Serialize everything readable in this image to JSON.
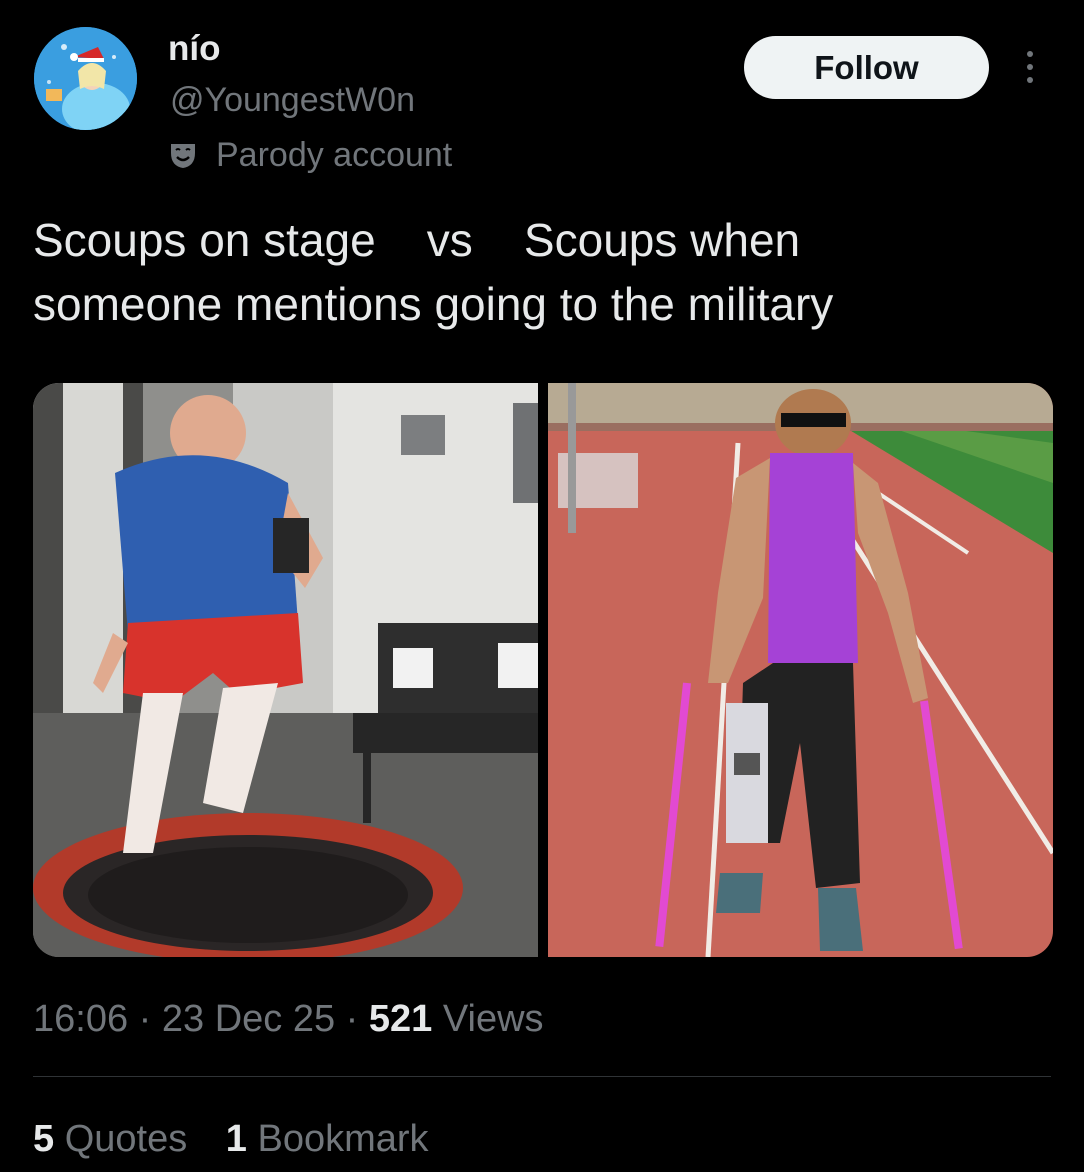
{
  "author": {
    "display_name": "nío",
    "handle": "@YoungestW0n",
    "label_text": "Parody account",
    "label_icon": "theater-mask-icon",
    "avatar_icon": "avatar-icon"
  },
  "actions": {
    "follow_label": "Follow",
    "more_icon": "more-options-icon"
  },
  "tweet": {
    "text": "Scoups on stage    vs    Scoups when\nsomeone mentions going to the military"
  },
  "media": {
    "images": [
      "gif-left-trampoline",
      "gif-right-crutches"
    ]
  },
  "meta": {
    "time": "16:06",
    "separator": "·",
    "date": "23 Dec 25",
    "views_count": "521",
    "views_label": "Views"
  },
  "stats": {
    "quotes_count": "5",
    "quotes_label": "Quotes",
    "bookmarks_count": "1",
    "bookmarks_label": "Bookmark"
  },
  "colors": {
    "background": "#000000",
    "primary_text": "#e7e9ea",
    "secondary_text": "#71767b",
    "follow_button_bg": "#eff3f4",
    "follow_button_text": "#0f1419",
    "divider": "#2f3336"
  }
}
